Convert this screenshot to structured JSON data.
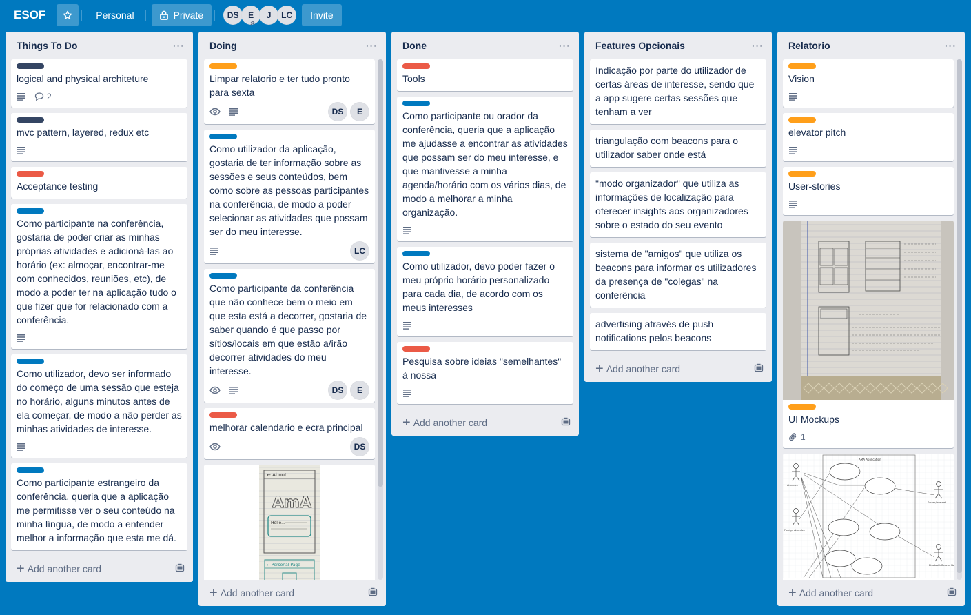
{
  "header": {
    "board_title": "ESOF",
    "star_icon": "star-icon",
    "team_label": "Personal",
    "visibility_label": "Private",
    "visibility_icon": "lock-icon",
    "members": [
      "DS",
      "E",
      "J",
      "LC"
    ],
    "invite_label": "Invite"
  },
  "colors": {
    "board_bg": "#0079bf",
    "label_dark": "#344563",
    "label_red": "#eb5a46",
    "label_blue": "#0079bf",
    "label_orange": "#ff9f1a"
  },
  "add_card_label": "Add another card",
  "lists": [
    {
      "title": "Things To Do",
      "cards": [
        {
          "label": "dark",
          "title": "logical and physical architeture",
          "description": true,
          "comments": "2"
        },
        {
          "label": "dark",
          "title": "mvc pattern, layered, redux etc",
          "description": true
        },
        {
          "label": "red",
          "title": "Acceptance testing"
        },
        {
          "label": "blue",
          "title": "Como participante na conferência, gostaria de poder criar as minhas próprias atividades e adicioná-las ao horário (ex: almoçar, encontrar-me com conhecidos, reuniões, etc), de modo a poder ter na aplicação tudo o que fizer que for relacionado com a conferência.",
          "description": true
        },
        {
          "label": "blue",
          "title": "Como utilizador, devo ser informado do começo de uma sessão que esteja no horário, alguns minutos antes de ela começar, de modo a não perder as minhas atividades de interesse.",
          "description": true
        },
        {
          "label": "blue",
          "title": "Como participante estrangeiro da conferência, queria que a aplicação me permitisse ver o seu conteúdo na minha língua, de modo a entender melhor a informação que esta me dá."
        }
      ]
    },
    {
      "title": "Doing",
      "cards": [
        {
          "label": "orange",
          "title": "Limpar relatorio e ter tudo pronto para sexta",
          "watch": true,
          "description": true,
          "members": [
            "DS",
            "E"
          ]
        },
        {
          "label": "blue",
          "title": "Como utilizador da aplicação, gostaria de ter informação sobre as sessões e seus conteúdos, bem como sobre as pessoas participantes na conferência, de modo a poder selecionar as atividades que possam ser do meu interesse.",
          "description": true,
          "members": [
            "LC"
          ]
        },
        {
          "label": "blue",
          "title": "Como participante da conferência que não conhece bem o meio em que esta está a decorrer, gostaria de saber quando é que passo por sítios/locais em que estão a/irão decorrer atividades do meu interesse.",
          "watch": true,
          "description": true,
          "members": [
            "DS",
            "E"
          ]
        },
        {
          "label": "red",
          "title": "melhorar calendario e ecra principal",
          "watch": true,
          "members": [
            "DS"
          ]
        },
        {
          "cover": "about-sketch",
          "cover_texts": [
            "← About",
            "AmA",
            "Hello...",
            "← Personal Page"
          ]
        }
      ]
    },
    {
      "title": "Done",
      "cards": [
        {
          "label": "red",
          "title": "Tools"
        },
        {
          "label": "blue",
          "title": "Como participante ou orador da conferência, queria que a aplicação me ajudasse a encontrar as atividades que possam ser do meu interesse, e que mantivesse a minha agenda/horário com os vários dias, de modo a melhorar a minha organização.",
          "description": true
        },
        {
          "label": "blue",
          "title": "Como utilizador, devo poder fazer o meu próprio horário personalizado para cada dia, de acordo com os meus interesses",
          "description": true
        },
        {
          "label": "red",
          "title": "Pesquisa sobre ideias \"semelhantes\" à nossa",
          "description": true
        }
      ]
    },
    {
      "title": "Features Opcionais",
      "cards": [
        {
          "title": "Indicação por parte do utilizador de certas áreas de interesse, sendo que a app sugere certas sessões que tenham a ver"
        },
        {
          "title": "triangulação com beacons para o utilizador saber onde está"
        },
        {
          "title": "\"modo organizador\" que utiliza as informações de localização para oferecer insights aos organizadores sobre o estado do seu evento"
        },
        {
          "title": "sistema de \"amigos\" que utiliza os beacons para informar os utilizadores da presença de \"colegas\" na conferência"
        },
        {
          "title": "advertising através de push notifications pelos beacons"
        }
      ]
    },
    {
      "title": "Relatorio",
      "cards": [
        {
          "label": "orange",
          "title": "Vision",
          "description": true
        },
        {
          "label": "orange",
          "title": "elevator pitch",
          "description": true
        },
        {
          "label": "orange",
          "title": "User-stories",
          "description": true
        },
        {
          "label": "orange",
          "title": "UI Mockups",
          "cover": "notebook-mockup",
          "attachments": "1"
        },
        {
          "cover": "use-case-diagram",
          "cover_texts": [
            "AMA Application",
            "Attendee",
            "Foreign Attendee",
            "Server/Internet",
            "Bluetooth Beacon Network"
          ]
        }
      ]
    }
  ]
}
